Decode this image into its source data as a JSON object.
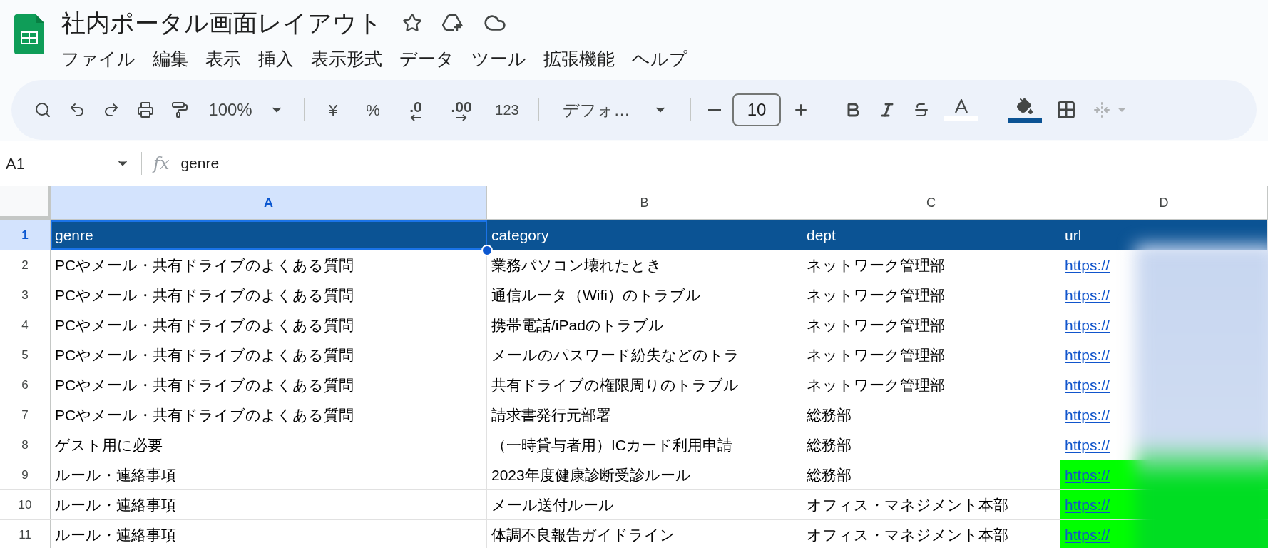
{
  "document": {
    "title": "社内ポータル画面レイアウト"
  },
  "menu": [
    "ファイル",
    "編集",
    "表示",
    "挿入",
    "表示形式",
    "データ",
    "ツール",
    "拡張機能",
    "ヘルプ"
  ],
  "toolbar": {
    "zoom": "100%",
    "currency": "¥",
    "percent": "%",
    "decimal_decrease": ".0",
    "decimal_increase": ".00",
    "number_format": "123",
    "font": "デフォ…",
    "font_size": "10",
    "text_color": {
      "color": "#ffffff"
    },
    "fill_color": {
      "color": "#0b5394"
    }
  },
  "formula_bar": {
    "cell_ref": "A1",
    "fx": "fx",
    "value": "genre"
  },
  "sheet": {
    "columns": [
      {
        "label": "A",
        "selected": true
      },
      {
        "label": "B",
        "selected": false
      },
      {
        "label": "C",
        "selected": false
      },
      {
        "label": "D",
        "selected": false
      }
    ],
    "rows": [
      {
        "number": "1",
        "kind": "header",
        "selected": true,
        "cells": [
          "genre",
          "category",
          "dept",
          "url"
        ]
      },
      {
        "number": "2",
        "kind": "data",
        "selected": false,
        "cells": [
          "PCやメール・共有ドライブのよくある質問",
          "業務パソコン壊れたとき",
          "ネットワーク管理部"
        ],
        "url": {
          "text": "https://"
        }
      },
      {
        "number": "3",
        "kind": "data",
        "selected": false,
        "cells": [
          "PCやメール・共有ドライブのよくある質問",
          "通信ルータ（Wifi）のトラブル",
          "ネットワーク管理部"
        ],
        "url": {
          "text": "https://"
        }
      },
      {
        "number": "4",
        "kind": "data",
        "selected": false,
        "cells": [
          "PCやメール・共有ドライブのよくある質問",
          "携帯電話/iPadのトラブル",
          "ネットワーク管理部"
        ],
        "url": {
          "text": "https://"
        }
      },
      {
        "number": "5",
        "kind": "data",
        "selected": false,
        "cells": [
          "PCやメール・共有ドライブのよくある質問",
          "メールのパスワード紛失などのトラ",
          "ネットワーク管理部"
        ],
        "url": {
          "text": "https://"
        }
      },
      {
        "number": "6",
        "kind": "data",
        "selected": false,
        "cells": [
          "PCやメール・共有ドライブのよくある質問",
          "共有ドライブの権限周りのトラブル",
          "ネットワーク管理部"
        ],
        "url": {
          "text": "https://"
        }
      },
      {
        "number": "7",
        "kind": "data",
        "selected": false,
        "cells": [
          "PCやメール・共有ドライブのよくある質問",
          "請求書発行元部署",
          "総務部"
        ],
        "url": {
          "text": "https://"
        }
      },
      {
        "number": "8",
        "kind": "data",
        "selected": false,
        "cells": [
          "ゲスト用に必要",
          "（一時貸与者用）ICカード利用申請",
          "総務部"
        ],
        "url": {
          "text": "https://"
        }
      },
      {
        "number": "9",
        "kind": "data",
        "selected": false,
        "cells": [
          "ルール・連絡事項",
          "2023年度健康診断受診ルール",
          "総務部"
        ],
        "url": {
          "text": "https://",
          "color": "#00ff00"
        }
      },
      {
        "number": "10",
        "kind": "data",
        "selected": false,
        "cells": [
          "ルール・連絡事項",
          "メール送付ルール",
          "オフィス・マネジメント本部"
        ],
        "url": {
          "text": "https://",
          "color": "#00ff00"
        }
      },
      {
        "number": "11",
        "kind": "data",
        "selected": false,
        "cells": [
          "ルール・連絡事項",
          "体調不良報告ガイドライン",
          "オフィス・マネジメント本部"
        ],
        "url": {
          "text": "https://",
          "color": "#00ff00"
        }
      }
    ]
  }
}
